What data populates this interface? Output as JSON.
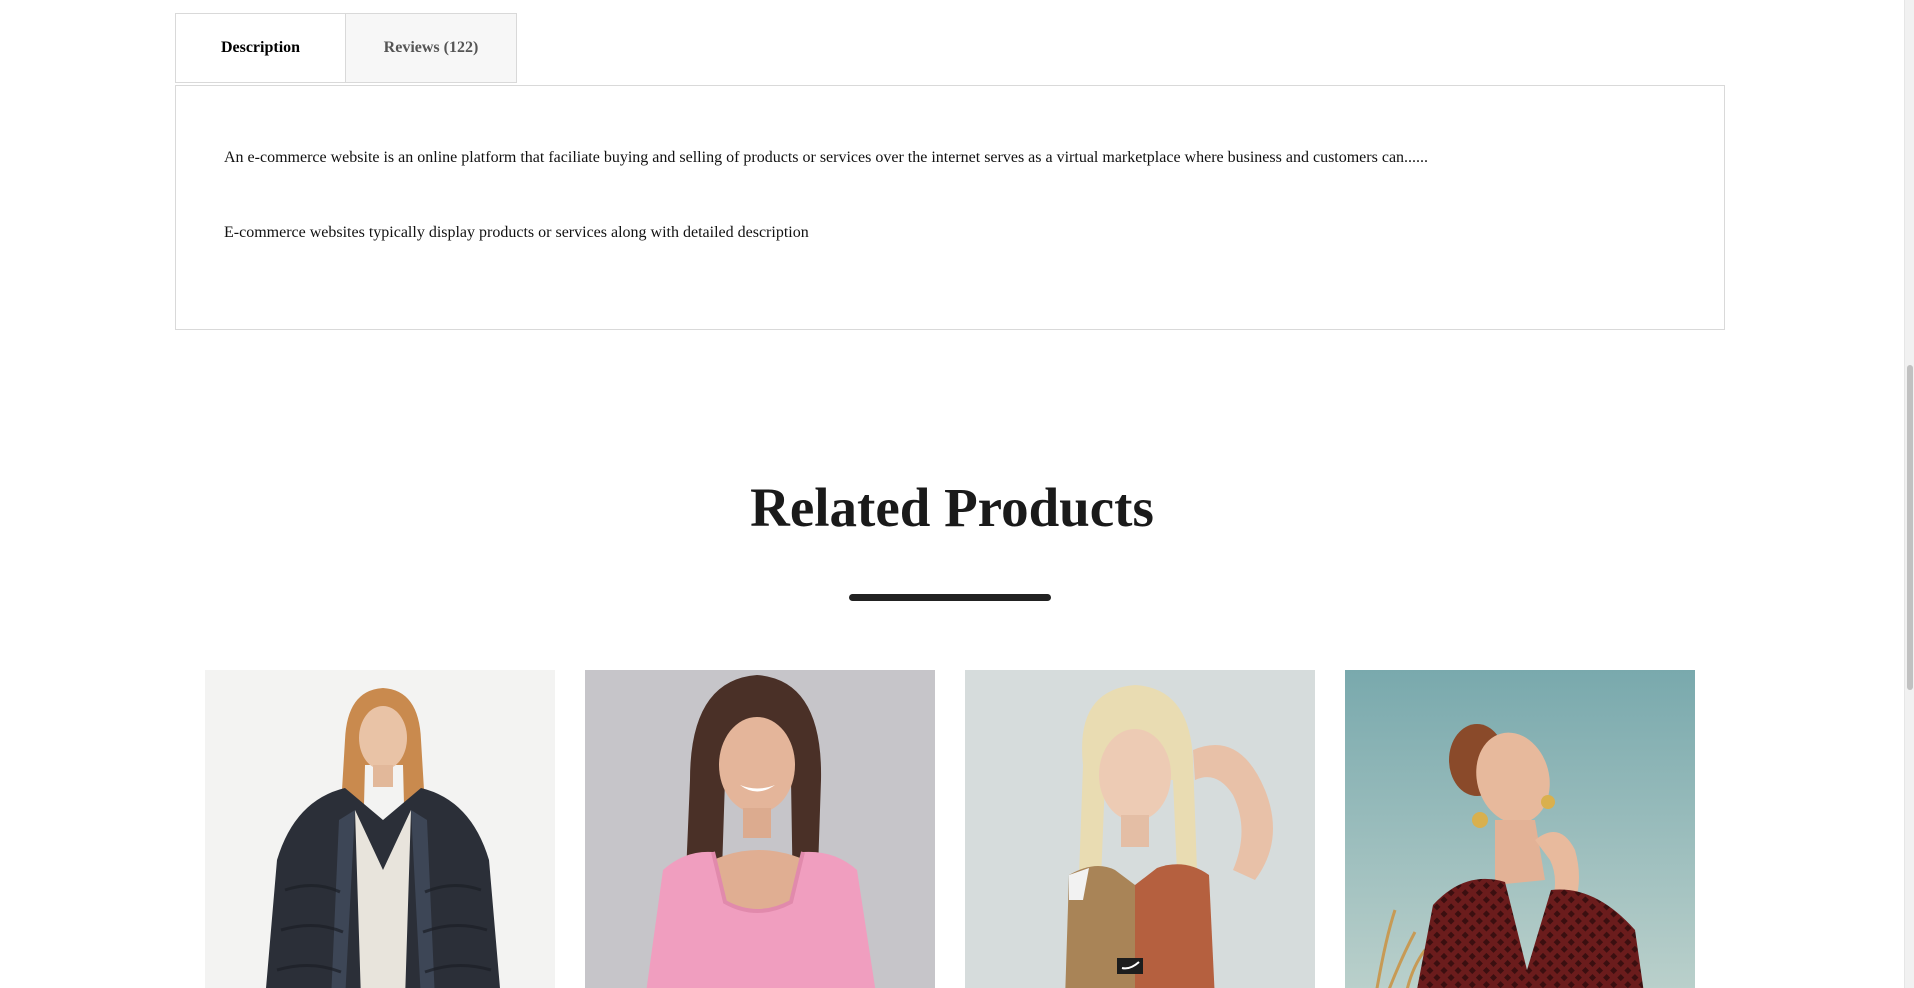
{
  "tabs": {
    "description_label": "Description",
    "reviews_label": "Reviews (122)"
  },
  "description": {
    "paragraph1": "An e-commerce website is an online platform that faciliate buying and selling of products or services over the internet serves as a virtual marketplace where business and customers can......",
    "paragraph2": "E-commerce websites typically display products or services along with detailed description"
  },
  "related": {
    "title": "Related Products"
  },
  "colors": {
    "text": "#000000",
    "title": "#1a1a1a",
    "border": "#d9d9d9",
    "underline": "#222222"
  }
}
